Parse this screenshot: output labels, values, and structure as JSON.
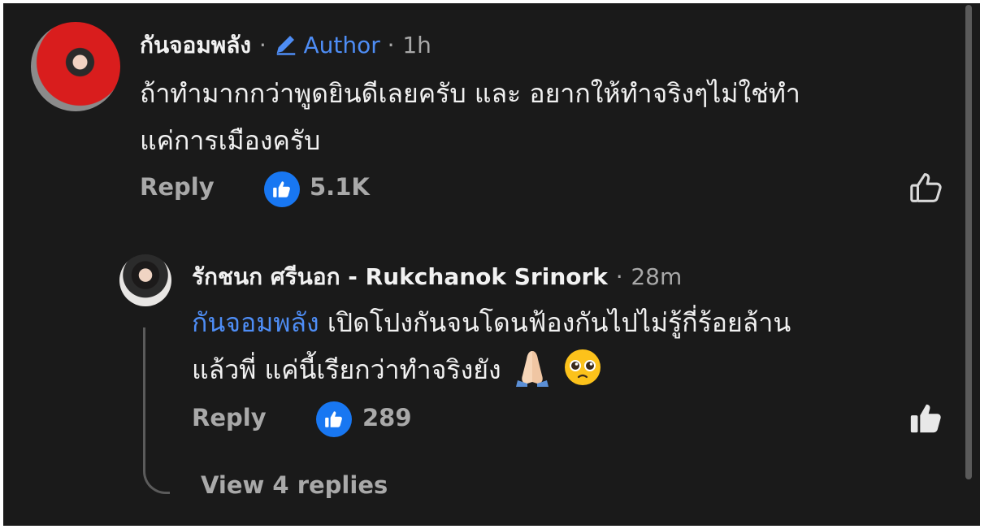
{
  "comment": {
    "author_name": "กันจอมพลัง",
    "author_badge": "Author",
    "time": "1h",
    "text_line1": "ถ้าทำมากกว่าพูดยินดีเลยครับ และ อยากให้ทำจริงๆไม่ใช่ทำ",
    "text_line2": "แค่การเมืองครับ",
    "reply_label": "Reply",
    "like_count": "5.1K"
  },
  "reply": {
    "author_name": "รักชนก ศรีนอก - Rukchanok Srinork",
    "time": "28m",
    "mention": "กันจอมพลัง",
    "text_line1": "เปิดโปงกันจนโดนฟ้องกันไปไม่รู้กี่ร้อยล้าน",
    "text_line2": "แล้วพี่ แค่นี้เรียกว่าทำจริงยัง",
    "reply_label": "Reply",
    "like_count": "289"
  },
  "view_replies_label": "View 4 replies",
  "separator": "·",
  "colors": {
    "background": "#1a1a1a",
    "accent": "#4e8df5",
    "like_blue": "#1877f2",
    "muted_text": "#a9a9a9"
  },
  "icons": [
    "pencil-icon",
    "thumbs-up-icon",
    "thumbs-up-outline-icon",
    "thumbs-up-filled-icon",
    "folded-hands-emoji",
    "pleading-face-emoji"
  ]
}
